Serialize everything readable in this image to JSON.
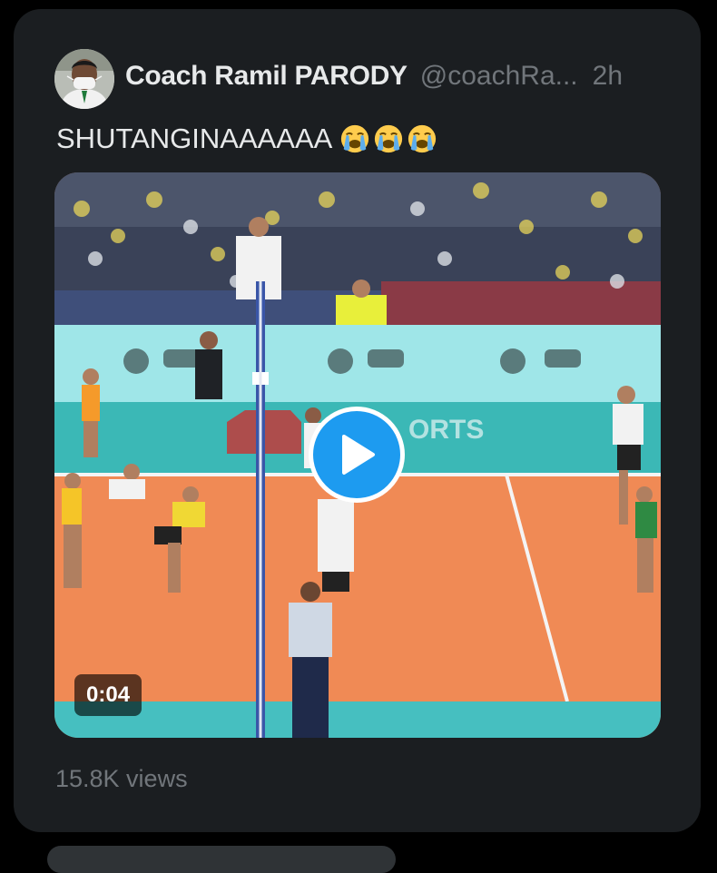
{
  "tweet": {
    "display_name": "Coach Ramil PARODY",
    "handle": "@coachRa...",
    "time": "2h",
    "text": "SHUTANGINAAAAAA",
    "emojis": [
      "loudly-crying-face",
      "loudly-crying-face",
      "loudly-crying-face"
    ],
    "video": {
      "duration": "0:04",
      "play_icon": "play-icon"
    },
    "views": "15.8K views"
  },
  "colors": {
    "background": "#000000",
    "card": "#1b1e21",
    "primary_text": "#e7e9ea",
    "secondary_text": "#71767b",
    "accent": "#1d9bf0"
  }
}
